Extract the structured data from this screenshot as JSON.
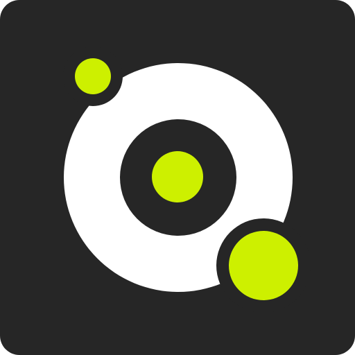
{
  "app_icon": {
    "name": "orbit-logo-icon",
    "colors": {
      "background": "#262626",
      "ring": "#ffffff",
      "accent": "#cdf000"
    }
  }
}
